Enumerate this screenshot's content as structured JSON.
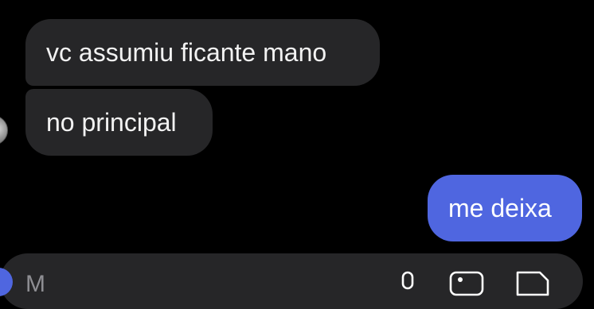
{
  "chat": {
    "messages": [
      {
        "text": "vc assumiu ficante mano",
        "direction": "received"
      },
      {
        "text": "no principal",
        "direction": "received"
      },
      {
        "text": "me deixa",
        "direction": "sent"
      }
    ]
  },
  "composer": {
    "placeholder": "M",
    "icons": [
      "microphone-icon",
      "photo-icon",
      "sticker-icon"
    ]
  },
  "colors": {
    "background": "#000000",
    "received_bubble": "#262628",
    "sent_bubble": "#4f66e0",
    "text": "#ffffff",
    "placeholder": "#8e8e93"
  }
}
